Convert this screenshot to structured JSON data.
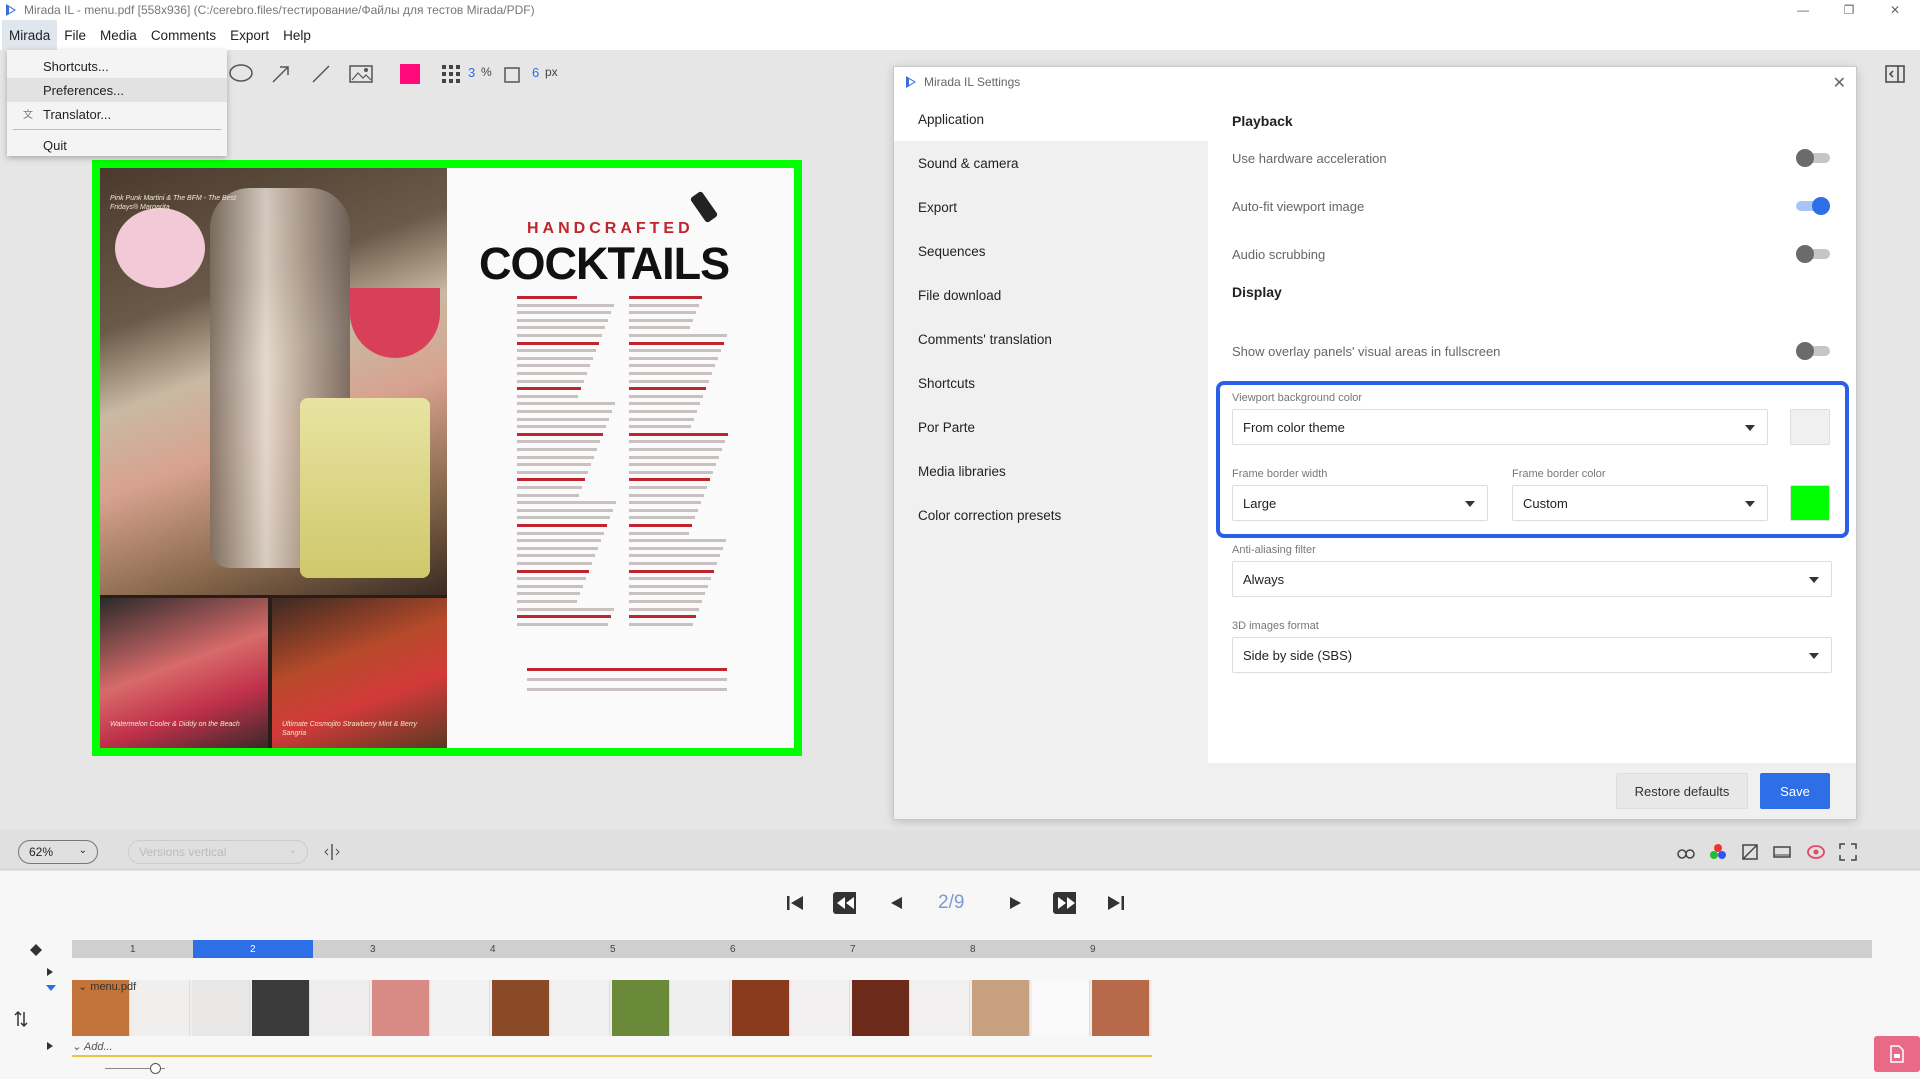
{
  "window": {
    "title": "Mirada IL - menu.pdf [558x936] (C:/cerebro.files/тестирование/Файлы для тестов Mirada/PDF)",
    "minimize": "—",
    "restore": "❐",
    "close": "✕"
  },
  "menubar": {
    "items": [
      "Mirada",
      "File",
      "Media",
      "Comments",
      "Export",
      "Help"
    ]
  },
  "dropdown": {
    "items": [
      "Shortcuts...",
      "Preferences...",
      "Translator...",
      "Quit"
    ]
  },
  "toolbar": {
    "grid_value": "3",
    "grid_unit": "%",
    "border_value": "6",
    "border_unit": "px",
    "draw_color": "#ff0a78"
  },
  "document": {
    "handcrafted": "HANDCRAFTED",
    "cocktails": "COCKTAILS",
    "caption_top": "Pink Punk Martini & The BFM - The Best Fridays® Margarita",
    "caption_bl": "Watermelon Cooler & Diddy on the Beach",
    "caption_br": "Ultimate Cosmojito Strawberry Mint & Berry Sangria",
    "frame_color": "#00ff00"
  },
  "settings": {
    "title": "Mirada IL Settings",
    "close": "✕",
    "sidebar": [
      "Application",
      "Sound & camera",
      "Export",
      "Sequences",
      "File download",
      "Comments' translation",
      "Shortcuts",
      "Por Parte",
      "Media libraries",
      "Color correction presets"
    ],
    "playback": {
      "title": "Playback",
      "rows": [
        {
          "label": "Use hardware acceleration",
          "on": false
        },
        {
          "label": "Auto-fit viewport image",
          "on": true
        },
        {
          "label": "Audio scrubbing",
          "on": false
        }
      ]
    },
    "display": {
      "title": "Display",
      "overlay_label": "Show overlay panels' visual areas in fullscreen",
      "bg_color_label": "Viewport background color",
      "bg_color_value": "From color theme",
      "bg_swatch": "#f0f0f0",
      "frame_width_label": "Frame border width",
      "frame_width_value": "Large",
      "frame_color_label": "Frame border color",
      "frame_color_value": "Custom",
      "frame_swatch": "#00ff00",
      "aa_label": "Anti-aliasing filter",
      "aa_value": "Always",
      "format_label": "3D images format",
      "format_value": "Side by side (SBS)"
    },
    "restore_label": "Restore defaults",
    "save_label": "Save",
    "accent": "#2e6ee6"
  },
  "viewer": {
    "zoom": "62%",
    "versions": "Versions vertical"
  },
  "playback": {
    "current": "2",
    "total": "9",
    "separator": "/"
  },
  "timeline": {
    "frames": [
      "1",
      "2",
      "3",
      "4",
      "5",
      "6",
      "7",
      "8",
      "9"
    ],
    "track_name": "menu.pdf",
    "add_label": "Add..."
  }
}
